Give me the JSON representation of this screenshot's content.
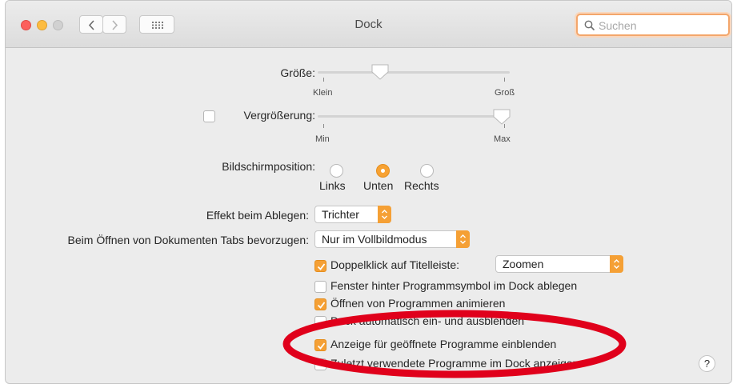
{
  "window": {
    "title": "Dock"
  },
  "search": {
    "placeholder": "Suchen"
  },
  "size": {
    "label": "Größe:",
    "min_label": "Klein",
    "max_label": "Groß",
    "value": 0.35
  },
  "magnification": {
    "label": "Vergrößerung:",
    "checked": false,
    "min_label": "Min",
    "max_label": "Max",
    "value": 1.0
  },
  "position": {
    "label": "Bildschirmposition:",
    "options": [
      {
        "label": "Links",
        "selected": false
      },
      {
        "label": "Unten",
        "selected": true
      },
      {
        "label": "Rechts",
        "selected": false
      }
    ]
  },
  "minimize_effect": {
    "label": "Effekt beim Ablegen:",
    "value": "Trichter"
  },
  "tabs_pref": {
    "label": "Beim Öffnen von Dokumenten Tabs bevorzugen:",
    "value": "Nur im Vollbildmodus"
  },
  "double_click": {
    "label": "Doppelklick auf Titelleiste:",
    "checked": true,
    "value": "Zoomen"
  },
  "options": [
    {
      "label": "Fenster hinter Programmsymbol im Dock ablegen",
      "checked": false
    },
    {
      "label": "Öffnen von Programmen animieren",
      "checked": true
    },
    {
      "label": "Dock automatisch ein- und ausblenden",
      "checked": false
    },
    {
      "label": "Anzeige für geöffnete Programme einblenden",
      "checked": true
    },
    {
      "label": "Zuletzt verwendete Programme im Dock anzeigen",
      "checked": false
    }
  ],
  "help": {
    "label": "?"
  },
  "colors": {
    "accent": "#f5a035",
    "highlight_ellipse": "#e0001b"
  }
}
